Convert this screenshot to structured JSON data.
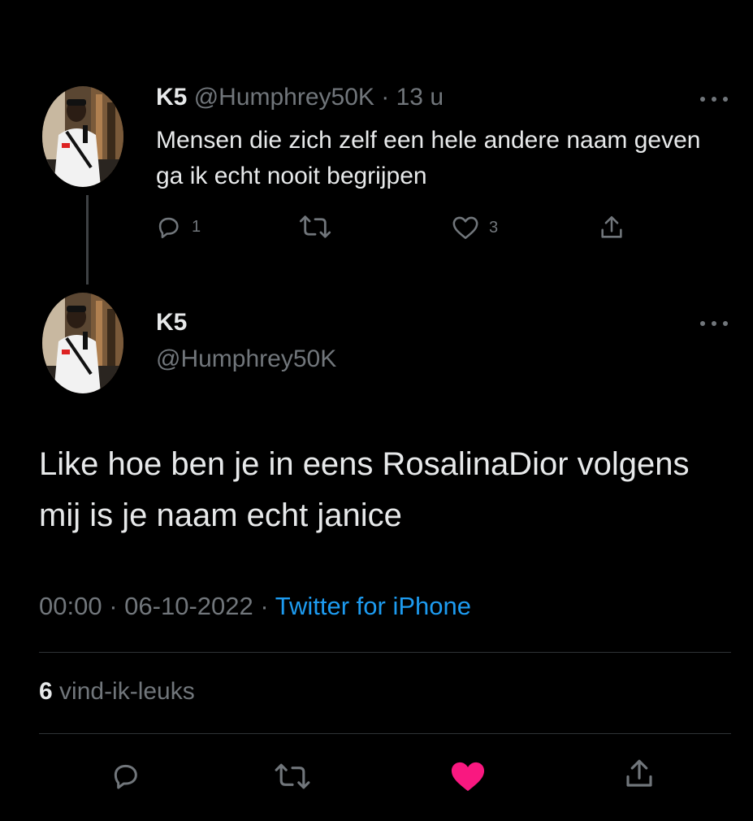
{
  "parent_tweet": {
    "display_name": "K5",
    "handle": "@Humphrey50K",
    "separator": "·",
    "time_ago": "13 u",
    "text": "Mensen die zich zelf een hele andere naam geven ga ik echt nooit begrijpen",
    "replies": "1",
    "likes": "3"
  },
  "main_tweet": {
    "display_name": "K5",
    "handle": "@Humphrey50K",
    "text": "Like hoe ben je in eens RosalinaDior volgens mij is je naam echt janice",
    "time": "00:00",
    "date": "06-10-2022",
    "separator": "·",
    "source": "Twitter for iPhone",
    "like_count": "6",
    "like_label": "vind-ik-leuks"
  },
  "icons": {
    "reply": "reply-icon",
    "retweet": "retweet-icon",
    "like": "heart-icon",
    "share": "share-icon",
    "more": "more-icon"
  },
  "colors": {
    "background": "#000000",
    "text": "#e7e9ea",
    "muted": "#71767b",
    "link": "#1d9bf0",
    "liked": "#f91880",
    "divider": "#2f3336"
  }
}
